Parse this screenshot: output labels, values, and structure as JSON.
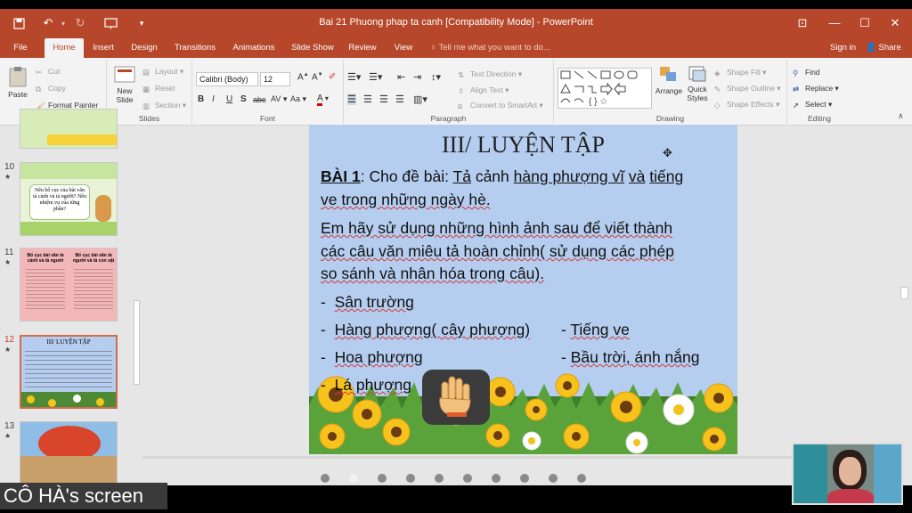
{
  "app": {
    "document_title": "Bai 21 Phuong phap ta canh [Compatibility Mode] - PowerPoint",
    "window_controls": [
      "restore-ribbon",
      "minimize",
      "maximize",
      "close"
    ]
  },
  "tabs": [
    {
      "label": "File"
    },
    {
      "label": "Home",
      "active": true
    },
    {
      "label": "Insert"
    },
    {
      "label": "Design"
    },
    {
      "label": "Transitions"
    },
    {
      "label": "Animations"
    },
    {
      "label": "Slide Show"
    },
    {
      "label": "Review"
    },
    {
      "label": "View"
    }
  ],
  "tellme": "Tell me what you want to do...",
  "signin": "Sign in",
  "share": "Share",
  "ribbon": {
    "clipboard": {
      "paste": "Paste",
      "cut": "Cut",
      "copy": "Copy",
      "format_painter": "Format Painter",
      "label": "Clipboard"
    },
    "slides": {
      "new_slide_1": "New",
      "new_slide_2": "Slide",
      "layout": "Layout",
      "reset": "Reset",
      "section": "Section",
      "label": "Slides"
    },
    "font": {
      "family": "Calibri (Body)",
      "size": "12",
      "label": "Font"
    },
    "paragraph": {
      "text_direction": "Text Direction",
      "align_text": "Align Text",
      "convert": "Convert to SmartArt",
      "label": "Paragraph"
    },
    "drawing": {
      "arrange": "Arrange",
      "quick_styles_1": "Quick",
      "quick_styles_2": "Styles",
      "shape_fill": "Shape Fill",
      "shape_outline": "Shape Outline",
      "shape_effects": "Shape Effects",
      "label": "Drawing"
    },
    "editing": {
      "find": "Find",
      "replace": "Replace",
      "select": "Select",
      "label": "Editing"
    }
  },
  "thumbnails": [
    {
      "number": "10",
      "star": "★",
      "text": "Nêu bố cục của bài văn tả cảnh và tả người? Nêu nhiệm vụ của từng phần?"
    },
    {
      "number": "11",
      "star": "★",
      "left_heading": "Bố cục bài văn tả cảnh và tả người",
      "right_heading": "Bố cục bài văn tả người và tả con vật"
    },
    {
      "number": "12",
      "star": "★",
      "title": "III/ LUYỆN TẬP",
      "selected": true
    },
    {
      "number": "13",
      "star": "★"
    }
  ],
  "slide": {
    "title": "III/ LUYỆN TẬP",
    "bai_label": "BÀI 1",
    "bai_rest_1": ": Cho đề bài: ",
    "topic_1": "Tả",
    "topic_2": "cảnh",
    "topic_3": "hàng phượng vĩ",
    "topic_4": "và",
    "topic_5": "tiếng",
    "line2": "ve trong những ngày hè.",
    "line3": "Em hãy sử dụng những hình ảnh sau để viết thành",
    "line4": "các câu văn miêu tả hoàn chỉnh( sử dụng các phép",
    "line5": "so sánh và nhân hóa trong câu).",
    "bullets": [
      {
        "dash": "-",
        "text": "Sân trường"
      },
      {
        "dash": "-",
        "text": "Hàng phượng( cây phượng)",
        "right_dash": "-",
        "right_text": "Tiếng ve"
      },
      {
        "dash": "-",
        "text": "Hoa phượng",
        "right_dash": "-",
        "right_text": "Bầu trời, ánh nắng"
      },
      {
        "dash": "-",
        "text": "Lá phượng"
      }
    ]
  },
  "overlay": {
    "screen_label": "CÔ HÀ's screen",
    "page_dots": 10,
    "active_dot": 2
  },
  "colors": {
    "accent": "#b7472a",
    "slide_bg": "#b5cdef",
    "spell_underline": "#d23a3a"
  }
}
